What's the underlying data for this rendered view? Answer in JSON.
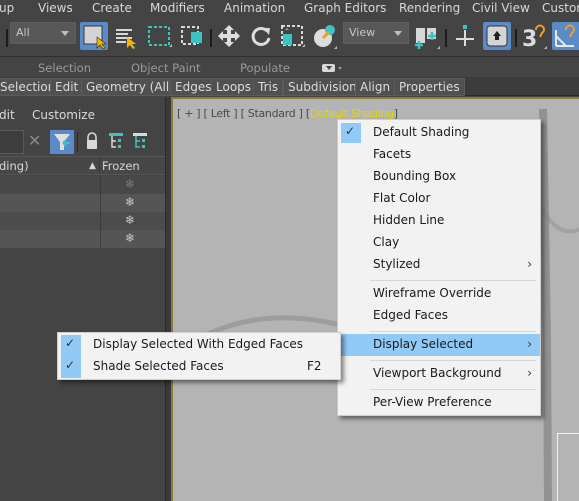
{
  "menubar": {
    "items": [
      "up",
      "Views",
      "Create",
      "Modifiers",
      "Animation",
      "Graph Editors",
      "Rendering",
      "Civil View",
      "Custon"
    ]
  },
  "toolbar": {
    "selection_filter": "All",
    "reference_coord": "View",
    "icons": [
      "select-object-icon",
      "select-by-name-icon",
      "rectangular-selection-icon",
      "window-crossing-icon",
      "select-move-icon",
      "select-rotate-icon",
      "select-scale-icon",
      "select-place-icon",
      "use-pivot-icon",
      "select-manipulate-icon",
      "keyboard-shortcut-override-icon",
      "snaps-toggle-icon",
      "angle-snap-icon"
    ]
  },
  "ribbon": {
    "group_labels": [
      "Selection",
      "Object Paint",
      "Populate"
    ],
    "tabs": [
      "Selection",
      "Edit",
      "Geometry (All)",
      "Edges",
      "Loops",
      "Tris",
      "Subdivision",
      "Align",
      "Properties"
    ]
  },
  "scene_explorer": {
    "menu": [
      "dit",
      "Customize"
    ],
    "columns": {
      "name": "ding)",
      "sort_indicator": "▲",
      "frozen": "Frozen"
    },
    "rows": [
      {
        "frozen_icon": "❄"
      },
      {
        "frozen_icon": "❄"
      },
      {
        "frozen_icon": "❄"
      },
      {
        "frozen_icon": "❄"
      }
    ]
  },
  "viewport": {
    "label_plus": "[ + ]",
    "label_view": "[ Left ]",
    "label_mode": "[ Standard ]",
    "label_shading_open": "[",
    "label_shading": "Default Shading",
    "label_shading_close": "]"
  },
  "shading_menu": {
    "items": [
      {
        "label": "Default Shading",
        "checked": true
      },
      {
        "label": "Facets"
      },
      {
        "label": "Bounding Box"
      },
      {
        "label": "Flat Color"
      },
      {
        "label": "Hidden Line"
      },
      {
        "label": "Clay"
      },
      {
        "label": "Stylized",
        "submenu": true
      },
      {
        "label": "Wireframe Override"
      },
      {
        "label": "Edged Faces"
      },
      {
        "label": "Display Selected",
        "submenu": true,
        "highlighted": true
      },
      {
        "label": "Viewport Background",
        "submenu": true
      },
      {
        "label": "Per-View Preference"
      }
    ],
    "submenu_arrow": "›",
    "check": "✓"
  },
  "display_selected_submenu": {
    "items": [
      {
        "label": "Display Selected With Edged Faces",
        "checked": true,
        "shortcut": ""
      },
      {
        "label": "Shade Selected Faces",
        "checked": true,
        "shortcut": "F2"
      }
    ]
  },
  "colors": {
    "ui_dark": "#444444",
    "active_blue": "#5b8ac8",
    "menu_highlight": "#91c9f7",
    "viewport_bg": "#b4b4b4",
    "viewport_label_active": "#e0d800",
    "teal_accent": "#3ec3c3",
    "orange_accent": "#f0a020"
  }
}
